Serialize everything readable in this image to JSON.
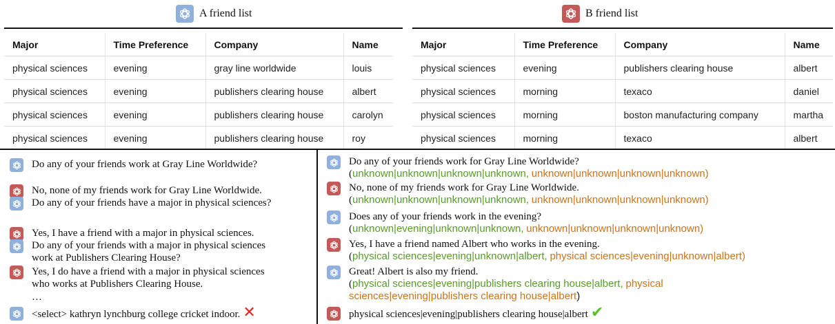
{
  "a_list": {
    "title": "A friend list",
    "headers": [
      "Major",
      "Time Preference",
      "Company",
      "Name"
    ],
    "rows": [
      [
        "physical sciences",
        "evening",
        "gray line worldwide",
        "louis"
      ],
      [
        "physical sciences",
        "evening",
        "publishers clearing house",
        "albert"
      ],
      [
        "physical sciences",
        "evening",
        "publishers clearing house",
        "carolyn"
      ],
      [
        "physical sciences",
        "evening",
        "publishers clearing house",
        "roy"
      ]
    ]
  },
  "b_list": {
    "title": "B friend list",
    "headers": [
      "Major",
      "Time Preference",
      "Company",
      "Name"
    ],
    "rows": [
      [
        "physical sciences",
        "evening",
        "publishers clearing house",
        "albert"
      ],
      [
        "physical sciences",
        "morning",
        "texaco",
        "daniel"
      ],
      [
        "physical sciences",
        "morning",
        "boston manufacturing company",
        "martha"
      ],
      [
        "physical sciences",
        "morning",
        "texaco",
        "albert"
      ]
    ]
  },
  "left_dialog": [
    {
      "speaker": "A",
      "lines": [
        "Do any of your friends work at Gray Line Worldwide?"
      ]
    },
    {
      "speaker": "B",
      "lines": [
        "No, none of my friends work for Gray Line Worldwide."
      ]
    },
    {
      "speaker": "A",
      "lines": [
        "Do any of your friends have a major in physical sciences?"
      ]
    },
    {
      "speaker": "B",
      "lines": [
        "Yes, I have a friend with a major in physical sciences."
      ]
    },
    {
      "speaker": "A",
      "lines": [
        "Do any of your friends with a major in physical sciences",
        "work at Publishers Clearing House?"
      ]
    },
    {
      "speaker": "B",
      "lines": [
        "Yes, I do have a friend with a major in physical sciences",
        "who works at Publishers Clearing House."
      ]
    },
    {
      "ellipsis": "…"
    },
    {
      "speaker": "A",
      "lines": [
        "<select> kathryn lynchburg college cricket indoor."
      ],
      "mark": "✕"
    }
  ],
  "right_dialog": [
    {
      "speaker": "A",
      "text": "Do any of your friends work for Gray Line Worldwide?",
      "belief_a": "unknown|unknown|unknown|unknown,",
      "belief_b": "unknown|unknown|unknown|unknown)"
    },
    {
      "speaker": "B",
      "text": "No, none of my friends work for Gray Line Worldwide.",
      "belief_a": "unknown|unknown|unknown|unknown,",
      "belief_b": "unknown|unknown|unknown|unknown)"
    },
    {
      "speaker": "A",
      "text": "Does any of your friends work in the evening?",
      "belief_a": "unknown|evening|unknown|unknown,",
      "belief_b": "unknown|unknown|unknown|unknown)"
    },
    {
      "speaker": "B",
      "text": "Yes, I have a friend named Albert who works in the evening.",
      "belief_a": "physical sciences|evening|unknown|albert,",
      "belief_b": "physical sciences|evening|unknown|albert)"
    },
    {
      "speaker": "A",
      "text": "Great! Albert is also my friend.",
      "belief_a": "physical sciences|evening|publishers clearing house|albert,",
      "belief_b_1": "physical",
      "belief_b_2": "sciences|evening|publishers clearing house|albert",
      "belief_close": ")"
    },
    {
      "speaker": "B",
      "text": "physical sciences|evening|publishers clearing house|albert",
      "mark": "✔"
    }
  ],
  "paren_open": "(",
  "colors": {
    "green": "#5a9a2a",
    "orange": "#c9741c",
    "a_avatar": "#8fb0dc",
    "b_avatar": "#c45a58",
    "x_red": "#e4231f",
    "check_green": "#5bbf2c"
  },
  "icons": {
    "avatar": "openai-logo-icon",
    "wrong": "cross-mark-icon",
    "right": "check-mark-icon"
  }
}
